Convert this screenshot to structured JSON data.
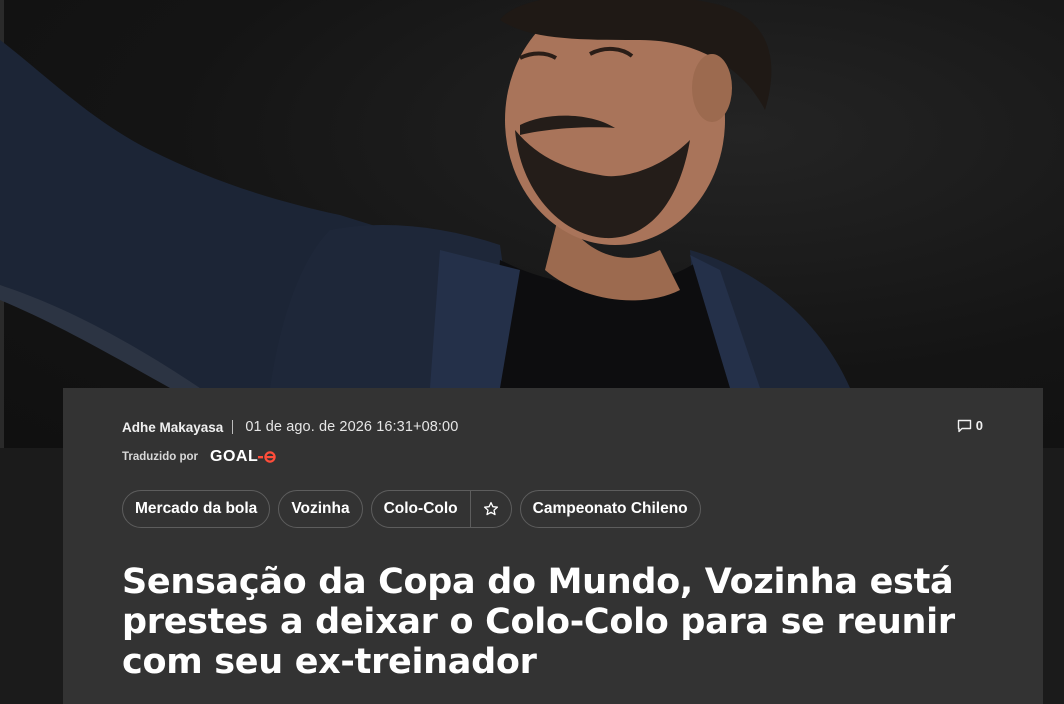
{
  "article": {
    "author": "Adhe Makayasa",
    "date": "01 de ago. de 2026 16:31+08:00",
    "comment_count": "0",
    "translated_by": "Traduzido por",
    "translator_brand": "GOAL",
    "headline": "Sensação da Copa do Mundo, Vozinha está prestes a deixar o Colo-Colo para se reunir com seu ex-treinador"
  },
  "tags": [
    {
      "label": "Mercado da bola"
    },
    {
      "label": "Vozinha"
    },
    {
      "label": "Colo-Colo",
      "favoritable": true
    },
    {
      "label": "Campeonato Chileno"
    }
  ],
  "icons": {
    "comment": "comment-icon",
    "favorite": "star-outline-icon",
    "brand_mark": "goal-logo"
  },
  "colors": {
    "card_background": "#333333",
    "page_background": "#1b1b1b",
    "brand_accent": "#ff4d3a"
  }
}
